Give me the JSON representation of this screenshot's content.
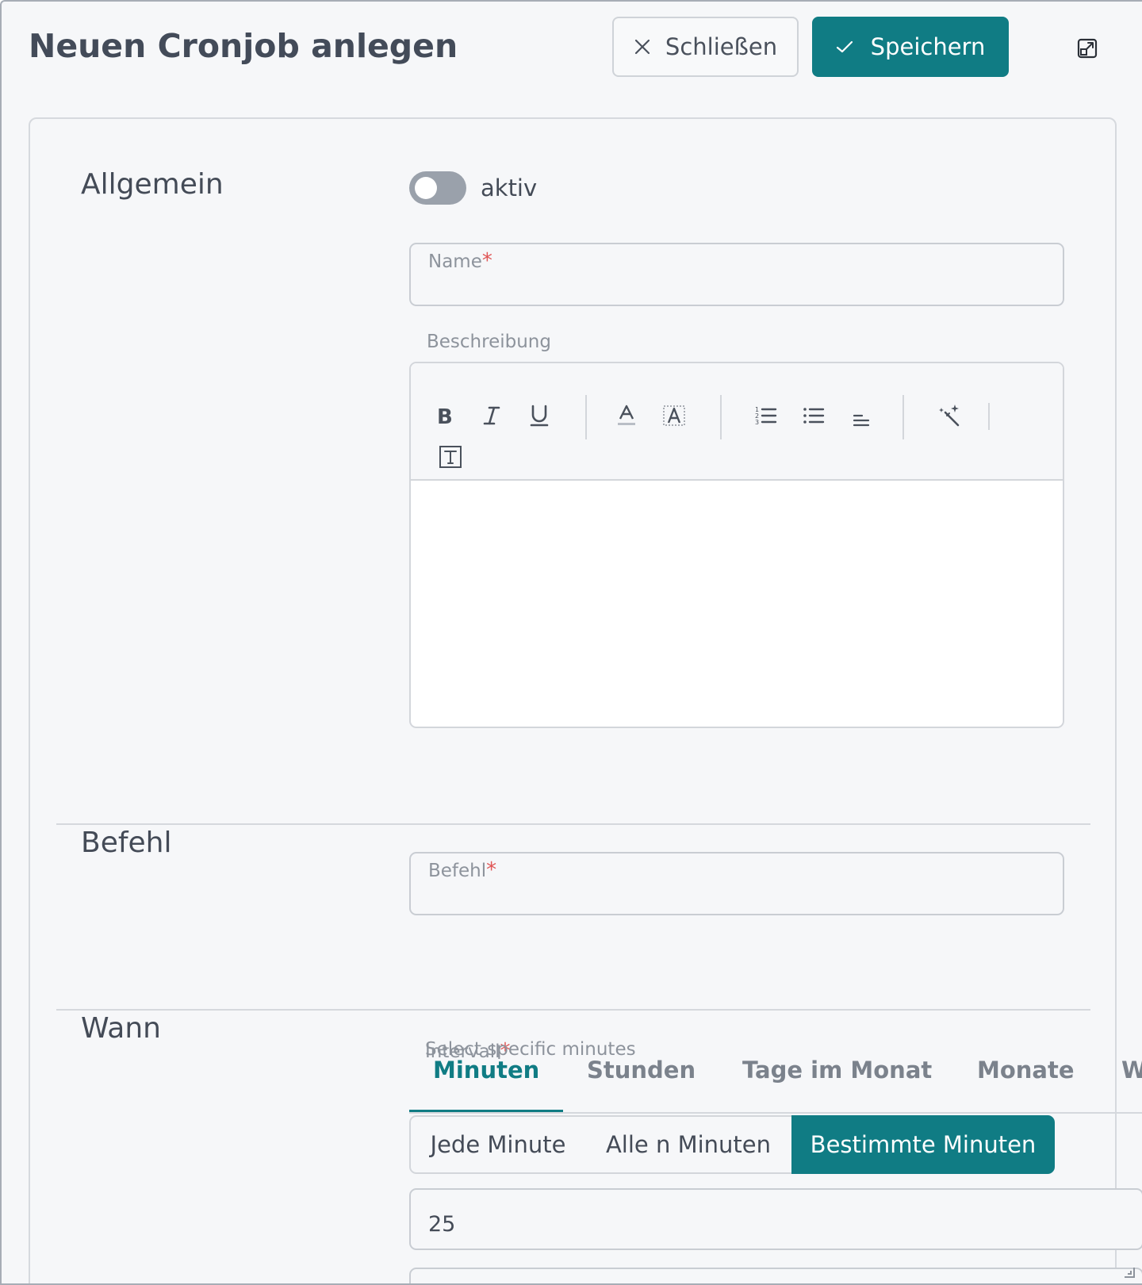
{
  "header": {
    "title": "Neuen Cronjob anlegen",
    "close_label": "Schließen",
    "save_label": "Speichern"
  },
  "sections": {
    "allgemein": {
      "title": "Allgemein",
      "toggle_label": "aktiv",
      "name_label": "Name",
      "required_mark": "*",
      "description_label": "Beschreibung"
    },
    "befehl": {
      "title": "Befehl",
      "command_label": "Befehl",
      "required_mark": "*"
    },
    "wann": {
      "title": "Wann",
      "hint_text": "Select specific minutes",
      "overlap_text": "Intervall",
      "required_mark": "*",
      "tabs": [
        {
          "label": "Minuten"
        },
        {
          "label": "Stunden"
        },
        {
          "label": "Tage im Monat"
        },
        {
          "label": "Monate"
        },
        {
          "label": "W"
        }
      ],
      "modes": [
        {
          "label": "Jede Minute"
        },
        {
          "label": "Alle n Minuten"
        },
        {
          "label": "Bestimmte Minuten"
        }
      ],
      "minutes_value": "25"
    }
  },
  "state": {
    "toggle_on": false,
    "active_tab": "Minuten",
    "active_mode": "Bestimmte Minuten"
  },
  "colors": {
    "accent": "#107c84",
    "required": "#e05656",
    "text": "#444b57",
    "muted": "#8d939c"
  }
}
